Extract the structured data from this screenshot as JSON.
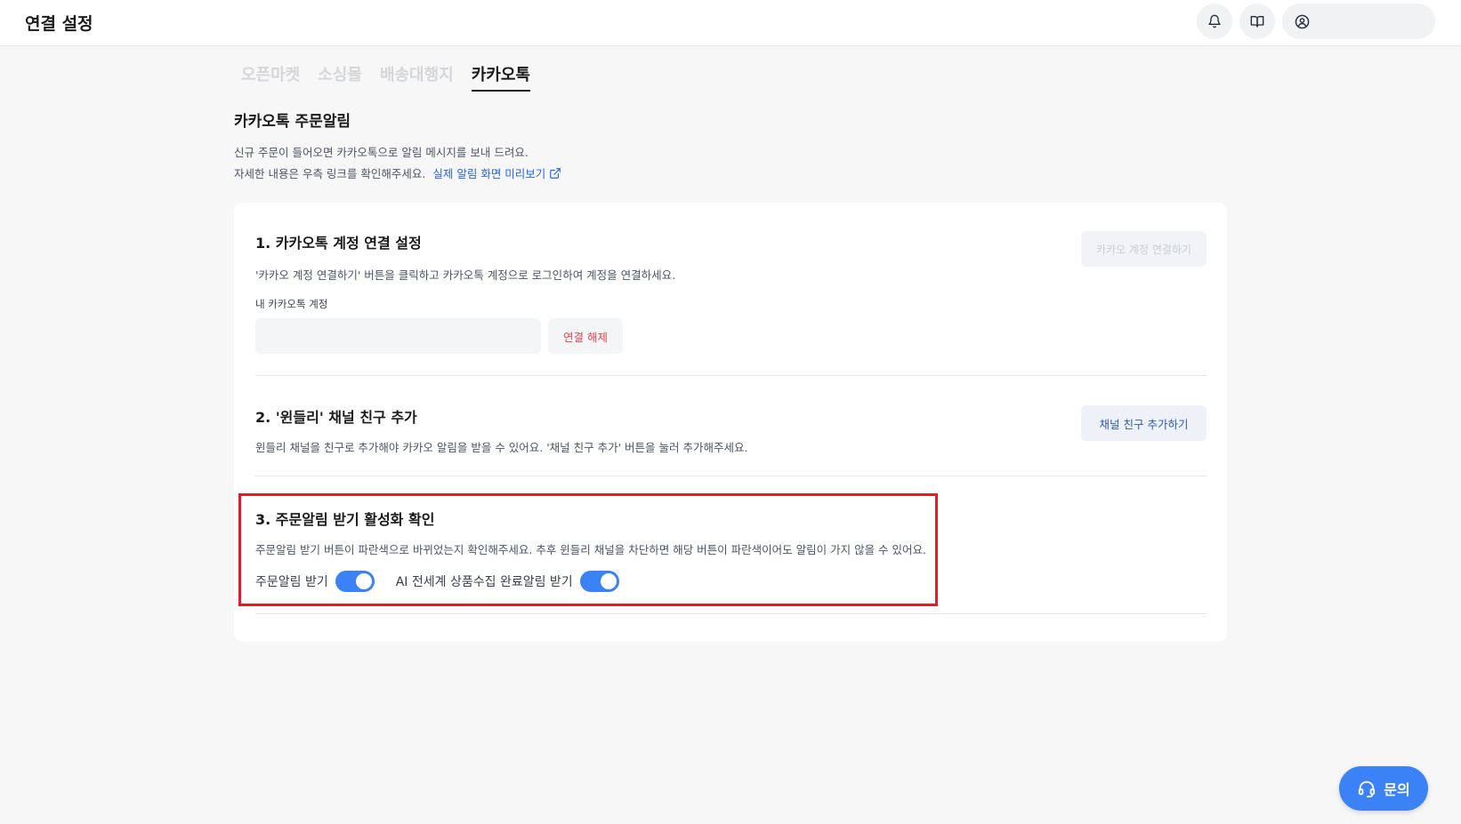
{
  "header": {
    "title": "연결 설정",
    "icons": [
      "bell-icon",
      "book-icon",
      "user-circle-icon"
    ]
  },
  "tabs": [
    {
      "label": "오픈마켓",
      "active": false
    },
    {
      "label": "소싱몰",
      "active": false
    },
    {
      "label": "배송대행지",
      "active": false
    },
    {
      "label": "카카오톡",
      "active": true
    }
  ],
  "section": {
    "title": "카카오톡 주문알림",
    "desc1": "신규 주문이 들어오면 카카오톡으로 알림 메시지를 보내 드려요.",
    "desc2": "자세한 내용은 우측 링크를 확인해주세요.",
    "preview_link": "실제 알림 화면 미리보기"
  },
  "step1": {
    "title": "1. 카카오톡 계정 연결 설정",
    "desc": "'카카오 계정 연결하기' 버튼을 클릭하고 카카오톡 계정으로 로그인하여 계정을 연결하세요.",
    "connect_button": "카카오 계정 연결하기",
    "account_label": "내 카카오톡 계정",
    "account_value": "",
    "disconnect_button": "연결 해제"
  },
  "step2": {
    "title": "2. '윈들리' 채널 친구 추가",
    "desc": "윈들리 채널을 친구로 추가해야 카카오 알림을 받을 수 있어요. '채널 친구 추가' 버튼을 눌러 추가해주세요.",
    "friend_button": "채널 친구 추가하기"
  },
  "step3": {
    "title": "3. 주문알림 받기 활성화 확인",
    "desc": "주문알림 받기 버튼이 파란색으로 바뀌었는지 확인해주세요. 추후 윈들리 채널을 차단하면 해당 버튼이 파란색이어도 알림이 가지 않을 수 있어요.",
    "toggles": [
      {
        "label": "주문알림 받기",
        "on": true
      },
      {
        "label": "AI 전세계 상품수집 완료알림 받기",
        "on": true
      }
    ]
  },
  "inquiry_button": "문의",
  "colors": {
    "accent": "#3b82f6",
    "highlight": "#e11d2a",
    "link": "#2563eb",
    "danger": "#e0474c"
  }
}
